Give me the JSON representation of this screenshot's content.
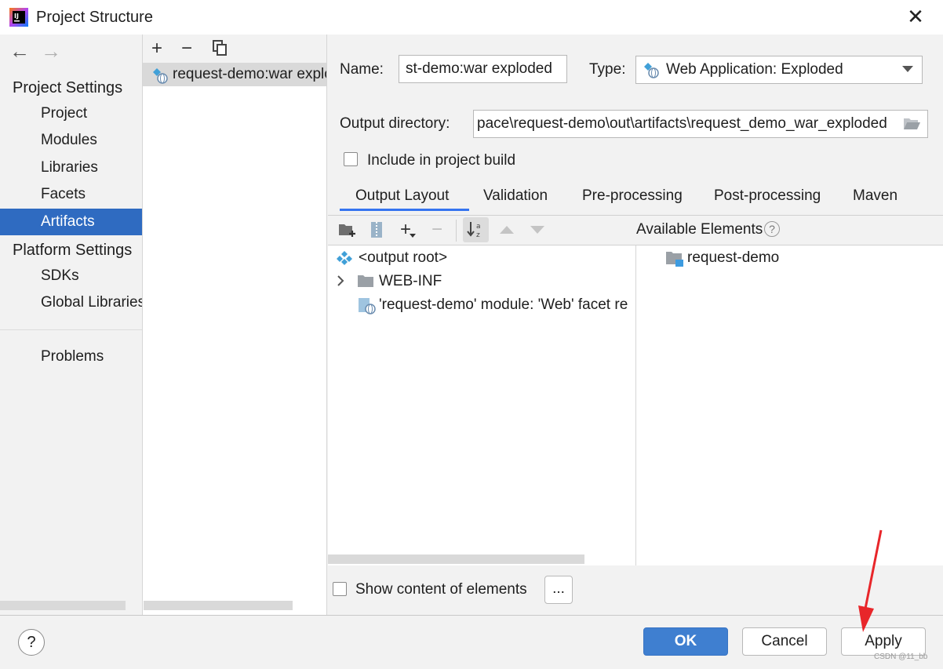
{
  "window": {
    "title": "Project Structure",
    "close": "✕"
  },
  "nav": {
    "back": "←",
    "forward": "→",
    "project_settings_header": "Project Settings",
    "project_settings_items": [
      "Project",
      "Modules",
      "Libraries",
      "Facets",
      "Artifacts"
    ],
    "platform_settings_header": "Platform Settings",
    "platform_settings_items": [
      "SDKs",
      "Global Libraries"
    ],
    "problems": "Problems",
    "selected": "Artifacts"
  },
  "list": {
    "toolbar": {
      "add": "+",
      "remove": "−"
    },
    "items": [
      "request-demo:war exploded"
    ]
  },
  "form": {
    "name_label": "Name:",
    "name_value": "st-demo:war exploded",
    "type_label": "Type:",
    "type_value": "Web Application: Exploded",
    "output_dir_label": "Output directory:",
    "output_dir_value": "pace\\request-demo\\out\\artifacts\\request_demo_war_exploded",
    "include_build_label": "Include in project build",
    "include_build_checked": false
  },
  "tabs": [
    "Output Layout",
    "Validation",
    "Pre-processing",
    "Post-processing",
    "Maven"
  ],
  "active_tab": "Output Layout",
  "output_layout": {
    "available_elements_label": "Available Elements",
    "tree": [
      {
        "label": "<output root>",
        "icon": "artifact-icon"
      },
      {
        "label": "WEB-INF",
        "icon": "folder-icon",
        "expandable": true
      },
      {
        "label": "'request-demo' module: 'Web' facet re",
        "icon": "web-facet-icon"
      }
    ],
    "available": [
      {
        "label": "request-demo",
        "icon": "module-folder-icon"
      }
    ],
    "show_content_label": "Show content of elements",
    "show_content_checked": false,
    "more_button": "..."
  },
  "buttons": {
    "help": "?",
    "ok": "OK",
    "cancel": "Cancel",
    "apply": "Apply"
  },
  "watermark": "CSDN @11_bb",
  "colors": {
    "selection": "#2f6bc1",
    "ok_button": "#3f7fd0",
    "tab_underline": "#3574f0",
    "arrow": "#e8262a"
  }
}
